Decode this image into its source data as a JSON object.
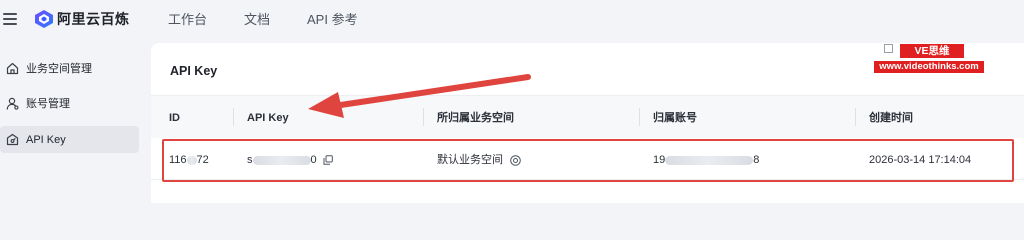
{
  "header": {
    "brand": "阿里云百炼",
    "nav": [
      "工作台",
      "文档",
      "API 参考"
    ]
  },
  "sidebar": {
    "items": [
      {
        "label": "业务空间管理",
        "icon": "house-icon",
        "active": false
      },
      {
        "label": "账号管理",
        "icon": "user-icon",
        "active": false
      },
      {
        "label": "API Key",
        "icon": "key-icon",
        "active": true
      }
    ]
  },
  "main": {
    "title": "API Key",
    "table": {
      "columns": [
        "ID",
        "API Key",
        "所归属业务空间",
        "归属账号",
        "创建时间"
      ],
      "rows": [
        {
          "id": "116",
          "id_suffix": "72",
          "api_key_prefix": "s",
          "api_key_suffix": "0",
          "workspace": "默认业务空间",
          "account_prefix": "19",
          "account_suffix": "8",
          "created_at": "2026-03-14 17:14:04"
        }
      ]
    }
  },
  "watermark": {
    "badge": "VE思维",
    "url": "www.videothinks.com"
  },
  "colors": {
    "accent_red": "#e0443e",
    "watermark_red": "#e02020",
    "page_bg": "#f3f4f7",
    "active_bg": "#e4e6eb"
  }
}
